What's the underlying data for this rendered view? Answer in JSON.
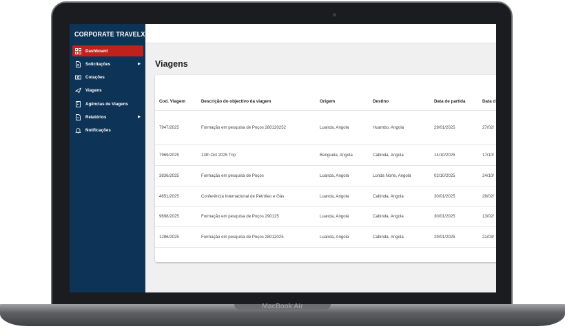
{
  "device": {
    "label": "MacBook Air"
  },
  "app": {
    "brand": "CORPORATE TRAVELX"
  },
  "sidebar": {
    "items": [
      {
        "label": "Dashboard",
        "icon": "dashboard-icon",
        "active": true
      },
      {
        "label": "Solicitações",
        "icon": "document-icon",
        "submenu": true
      },
      {
        "label": "Cotações",
        "icon": "money-icon"
      },
      {
        "label": "Viagens",
        "icon": "plane-icon"
      },
      {
        "label": "Agências de Viagens",
        "icon": "building-icon"
      },
      {
        "label": "Relatórios",
        "icon": "report-icon",
        "submenu": true
      },
      {
        "label": "Notificações",
        "icon": "bell-icon"
      }
    ]
  },
  "main": {
    "title": "Viagens",
    "table": {
      "headers": [
        "Cod. Viagem",
        "Descrição do objectivo da viagem",
        "Origem",
        "Destino",
        "Data de partida",
        "Data d"
      ],
      "rows": [
        [
          "7947/2025",
          "Formação em pesquisa de Poços 280120252",
          "Luanda, Angola",
          "Huambo, Angola",
          "29/01/2025",
          "27/02/"
        ],
        [
          "7969/2025",
          "13th Oct 2025 Trip",
          "Benguela, Angola",
          "Cabinda, Angola",
          "14/10/2025",
          "17/10/"
        ],
        [
          "3836/2025",
          "Formação em pesquisa de Poços",
          "Luanda, Angola",
          "Lunda Norte, Angola",
          "02/10/2025",
          "24/10/"
        ],
        [
          "4651/2025",
          "Conferência Internacional de Petróleo e Gás",
          "Luanda, Angola",
          "Cabinda, Angola",
          "30/01/2025",
          "28/02/"
        ],
        [
          "9698/2025",
          "Formação em pesquisa de Poços 290125",
          "Luanda, Angola",
          "Cabinda, Angola",
          "30/01/2025",
          "13/02/"
        ],
        [
          "1286/2025",
          "Formação em pesquisa de Poços 28012025",
          "Luanda, Angola",
          "Cabinda, Angola",
          "29/01/2025",
          "21/03/"
        ]
      ]
    }
  },
  "colors": {
    "sidebar": "#0d3356",
    "active": "#c0221b"
  }
}
